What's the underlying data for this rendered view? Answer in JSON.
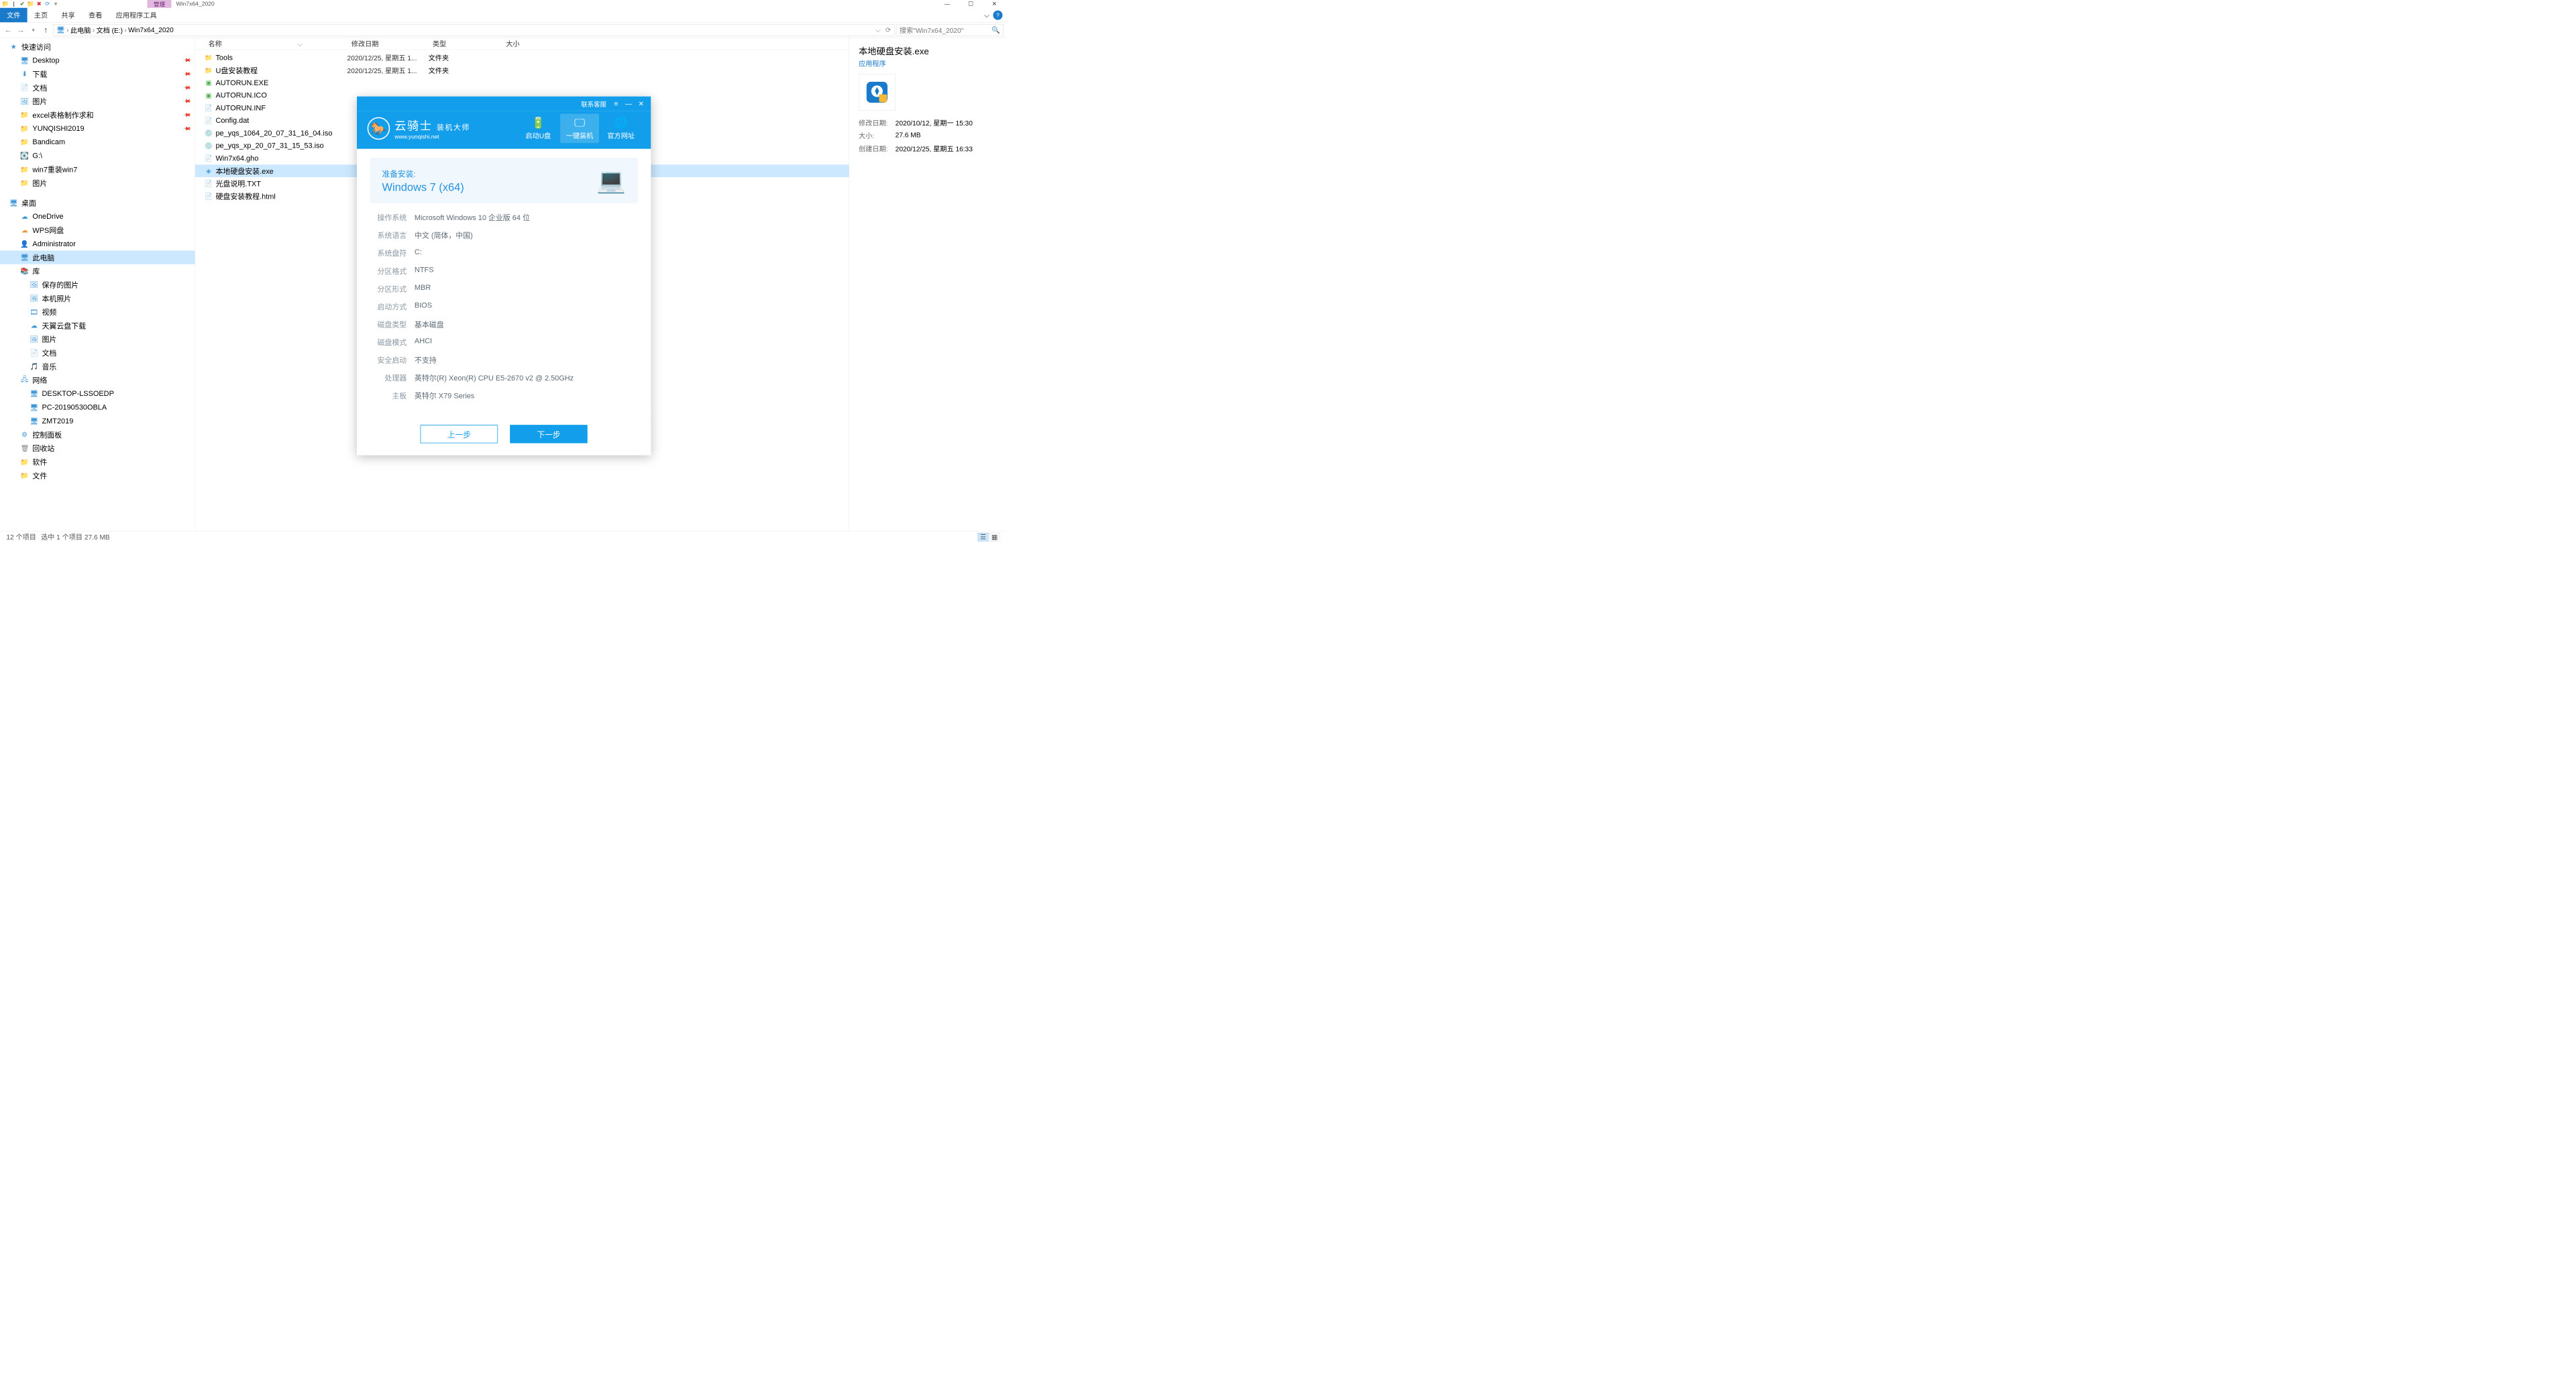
{
  "window": {
    "title": "Win7x64_2020",
    "manage_tab": "管理"
  },
  "ribbon": {
    "tabs": [
      "文件",
      "主页",
      "共享",
      "查看",
      "应用程序工具"
    ],
    "active": 0
  },
  "address": {
    "parts": [
      "此电脑",
      "文档 (E:)",
      "Win7x64_2020"
    ],
    "search_placeholder": "搜索\"Win7x64_2020\""
  },
  "columns": {
    "name": "名称",
    "date": "修改日期",
    "type": "类型",
    "size": "大小"
  },
  "sidebar": {
    "quick": "快速访问",
    "quick_items": [
      {
        "label": "Desktop",
        "pin": true,
        "ic": "🖥",
        "cls": "fc-blue"
      },
      {
        "label": "下载",
        "pin": true,
        "ic": "⬇",
        "cls": "fc-blue"
      },
      {
        "label": "文档",
        "pin": true,
        "ic": "📄",
        "cls": "fc-blue"
      },
      {
        "label": "图片",
        "pin": true,
        "ic": "🖼",
        "cls": "fc-blue"
      },
      {
        "label": "excel表格制作求和",
        "pin": true,
        "ic": "📁",
        "cls": "fc-folder"
      },
      {
        "label": "YUNQISHI2019",
        "pin": true,
        "ic": "📁",
        "cls": "fc-folder"
      },
      {
        "label": "Bandicam",
        "pin": false,
        "ic": "📁",
        "cls": "fc-folder"
      },
      {
        "label": "G:\\",
        "pin": false,
        "ic": "💽",
        "cls": "fc-gray"
      },
      {
        "label": "win7重装win7",
        "pin": false,
        "ic": "📁",
        "cls": "fc-folder"
      },
      {
        "label": "图片",
        "pin": false,
        "ic": "📁",
        "cls": "fc-folder"
      }
    ],
    "desktop": "桌面",
    "desktop_items": [
      {
        "label": "OneDrive",
        "ic": "☁",
        "cls": "fc-blue"
      },
      {
        "label": "WPS网盘",
        "ic": "☁",
        "cls": "fc-orange"
      },
      {
        "label": "Administrator",
        "ic": "👤",
        "cls": "fc-folder"
      },
      {
        "label": "此电脑",
        "ic": "🖥",
        "cls": "fc-blue",
        "selected": true
      },
      {
        "label": "库",
        "ic": "📚",
        "cls": "fc-folder"
      }
    ],
    "lib_items": [
      {
        "label": "保存的图片",
        "ic": "🖼",
        "cls": "fc-blue"
      },
      {
        "label": "本机照片",
        "ic": "🖼",
        "cls": "fc-blue"
      },
      {
        "label": "视频",
        "ic": "🎞",
        "cls": "fc-blue"
      },
      {
        "label": "天翼云盘下载",
        "ic": "☁",
        "cls": "fc-blue"
      },
      {
        "label": "图片",
        "ic": "🖼",
        "cls": "fc-blue"
      },
      {
        "label": "文档",
        "ic": "📄",
        "cls": "fc-blue"
      },
      {
        "label": "音乐",
        "ic": "🎵",
        "cls": "fc-blue"
      }
    ],
    "network": "网络",
    "net_items": [
      {
        "label": "DESKTOP-LSSOEDP",
        "ic": "🖥",
        "cls": "fc-blue"
      },
      {
        "label": "PC-20190530OBLA",
        "ic": "🖥",
        "cls": "fc-blue"
      },
      {
        "label": "ZMT2019",
        "ic": "🖥",
        "cls": "fc-blue"
      }
    ],
    "control_panel": "控制面板",
    "recycle": "回收站",
    "software": "软件",
    "files": "文件"
  },
  "files": [
    {
      "name": "Tools",
      "date": "2020/12/25, 星期五 1...",
      "type": "文件夹",
      "ic": "📁",
      "cls": "fc-folder"
    },
    {
      "name": "U盘安装教程",
      "date": "2020/12/25, 星期五 1...",
      "type": "文件夹",
      "ic": "📁",
      "cls": "fc-folder"
    },
    {
      "name": "AUTORUN.EXE",
      "date": "",
      "type": "",
      "ic": "▣",
      "cls": "fc-green"
    },
    {
      "name": "AUTORUN.ICO",
      "date": "",
      "type": "",
      "ic": "▣",
      "cls": "fc-green"
    },
    {
      "name": "AUTORUN.INF",
      "date": "",
      "type": "",
      "ic": "📄",
      "cls": "fc-gray"
    },
    {
      "name": "Config.dat",
      "date": "",
      "type": "",
      "ic": "📄",
      "cls": "fc-gray"
    },
    {
      "name": "pe_yqs_1064_20_07_31_16_04.iso",
      "date": "",
      "type": "",
      "ic": "💿",
      "cls": "fc-gray"
    },
    {
      "name": "pe_yqs_xp_20_07_31_15_53.iso",
      "date": "",
      "type": "",
      "ic": "💿",
      "cls": "fc-gray"
    },
    {
      "name": "Win7x64.gho",
      "date": "",
      "type": "",
      "ic": "📄",
      "cls": "fc-gray"
    },
    {
      "name": "本地硬盘安装.exe",
      "date": "",
      "type": "",
      "ic": "◈",
      "cls": "fc-blue",
      "selected": true
    },
    {
      "name": "光盘说明.TXT",
      "date": "",
      "type": "",
      "ic": "📄",
      "cls": "fc-gray"
    },
    {
      "name": "硬盘安装教程.html",
      "date": "",
      "type": "",
      "ic": "📄",
      "cls": "fc-gray"
    }
  ],
  "details": {
    "title": "本地硬盘安装.exe",
    "subtitle": "应用程序",
    "meta": [
      {
        "k": "修改日期:",
        "v": "2020/10/12, 星期一 15:30"
      },
      {
        "k": "大小:",
        "v": "27.6 MB"
      },
      {
        "k": "创建日期:",
        "v": "2020/12/25, 星期五 16:33"
      }
    ]
  },
  "status": {
    "items": "12 个项目",
    "selected": "选中 1 个项目  27.6 MB"
  },
  "installer": {
    "contact": "联系客服",
    "brand": "云骑士",
    "brand_sub": "装机大师",
    "url": "www.yunqishi.net",
    "nav": [
      {
        "label": "启动U盘",
        "ic": "🔋"
      },
      {
        "label": "一键装机",
        "ic": "🖵",
        "active": true
      },
      {
        "label": "官方网址",
        "ic": "🌐"
      }
    ],
    "card": {
      "l1": "准备安装:",
      "l2": "Windows 7 (x64)"
    },
    "info": [
      {
        "k": "操作系统",
        "v": "Microsoft Windows 10 企业版 64 位"
      },
      {
        "k": "系统语言",
        "v": "中文 (简体，中国)"
      },
      {
        "k": "系统盘符",
        "v": "C:"
      },
      {
        "k": "分区格式",
        "v": "NTFS"
      },
      {
        "k": "分区形式",
        "v": "MBR"
      },
      {
        "k": "启动方式",
        "v": "BIOS"
      },
      {
        "k": "磁盘类型",
        "v": "基本磁盘"
      },
      {
        "k": "磁盘模式",
        "v": "AHCI"
      },
      {
        "k": "安全启动",
        "v": "不支持"
      },
      {
        "k": "处理器",
        "v": "英特尔(R) Xeon(R) CPU E5-2670 v2 @ 2.50GHz"
      },
      {
        "k": "主板",
        "v": "英特尔 X79 Series"
      }
    ],
    "btn_prev": "上一步",
    "btn_next": "下一步"
  }
}
